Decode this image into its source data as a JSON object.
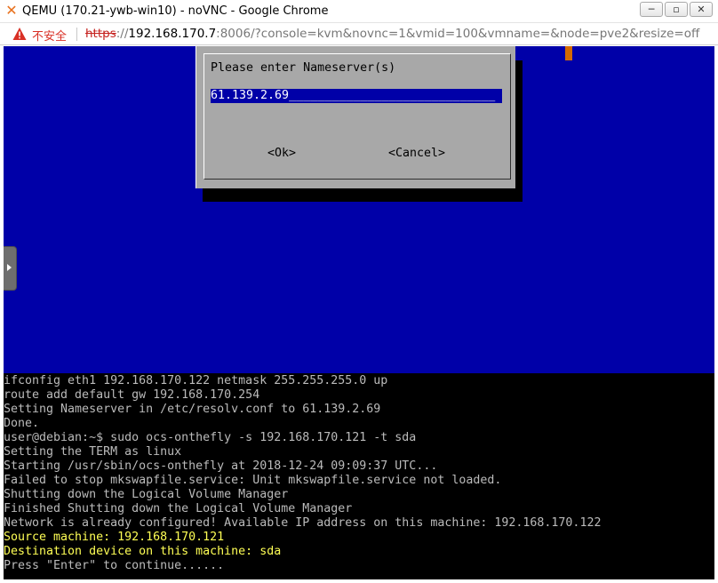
{
  "window": {
    "title": "QEMU (170.21-ywb-win10) - noVNC - Google Chrome",
    "minimize_label": "─",
    "maximize_label": "▫",
    "close_label": "✕"
  },
  "address_bar": {
    "security_label": "不安全",
    "url_scheme": "https",
    "url_sep": "://",
    "url_host": "192.168.170.7",
    "url_rest": ":8006/?console=kvm&novnc=1&vmid=100&vmname=&node=pve2&resize=off"
  },
  "dialog": {
    "prompt": "Please enter Nameserver(s)",
    "input_value": "61.139.2.69",
    "input_filler": "_____________________________",
    "ok_label": "<Ok>",
    "cancel_label": "<Cancel>"
  },
  "terminal": {
    "lines": [
      {
        "text": "ifconfig eth1 192.168.170.122 netmask 255.255.255.0 up"
      },
      {
        "text": "route add default gw 192.168.170.254"
      },
      {
        "text": "Setting Nameserver in /etc/resolv.conf to 61.139.2.69"
      },
      {
        "text": "Done."
      },
      {
        "text": "user@debian:~$ sudo ocs-onthefly -s 192.168.170.121 -t sda"
      },
      {
        "text": "Setting the TERM as linux"
      },
      {
        "text": "Starting /usr/sbin/ocs-onthefly at 2018-12-24 09:09:37 UTC..."
      },
      {
        "text": "Failed to stop mkswapfile.service: Unit mkswapfile.service not loaded."
      },
      {
        "text": "Shutting down the Logical Volume Manager"
      },
      {
        "text": "Finished Shutting down the Logical Volume Manager"
      },
      {
        "text": "Network is already configured! Available IP address on this machine: 192.168.170.122"
      },
      {
        "text": "Source machine: 192.168.170.121"
      },
      {
        "text": "Destination device on this machine: sda"
      },
      {
        "text": "Press \"Enter\" to continue......"
      }
    ],
    "highlight_color": "#ffff55",
    "text_color": "#bbbbbb"
  },
  "colors": {
    "tui_background": "#0000a8",
    "dialog_background": "#a8a8a8",
    "insecure_red": "#d93025"
  },
  "icons": {
    "app": "proxmox-x-icon",
    "warning": "warning-triangle-icon",
    "sidebar_toggle": "play-arrow-icon"
  }
}
